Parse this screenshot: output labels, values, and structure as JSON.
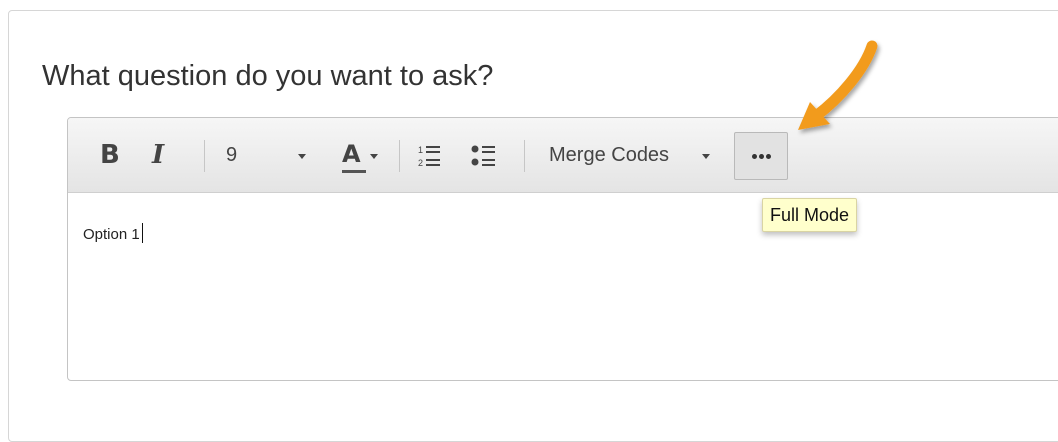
{
  "question": {
    "title": "What question do you want to ask?"
  },
  "toolbar": {
    "bold_label": "B",
    "italic_label": "I",
    "font_size_value": "9",
    "font_color_label": "A",
    "merge_codes_label": "Merge Codes"
  },
  "editor": {
    "content": "Option 1"
  },
  "tooltip": {
    "text": "Full Mode"
  },
  "colors": {
    "arrow": "#f29b1f",
    "tooltip_bg": "#ffffcc"
  },
  "icons": [
    "bold-icon",
    "italic-icon",
    "font-color-icon",
    "numbered-list-icon",
    "bulleted-list-icon",
    "more-options-icon",
    "annotation-arrow"
  ]
}
